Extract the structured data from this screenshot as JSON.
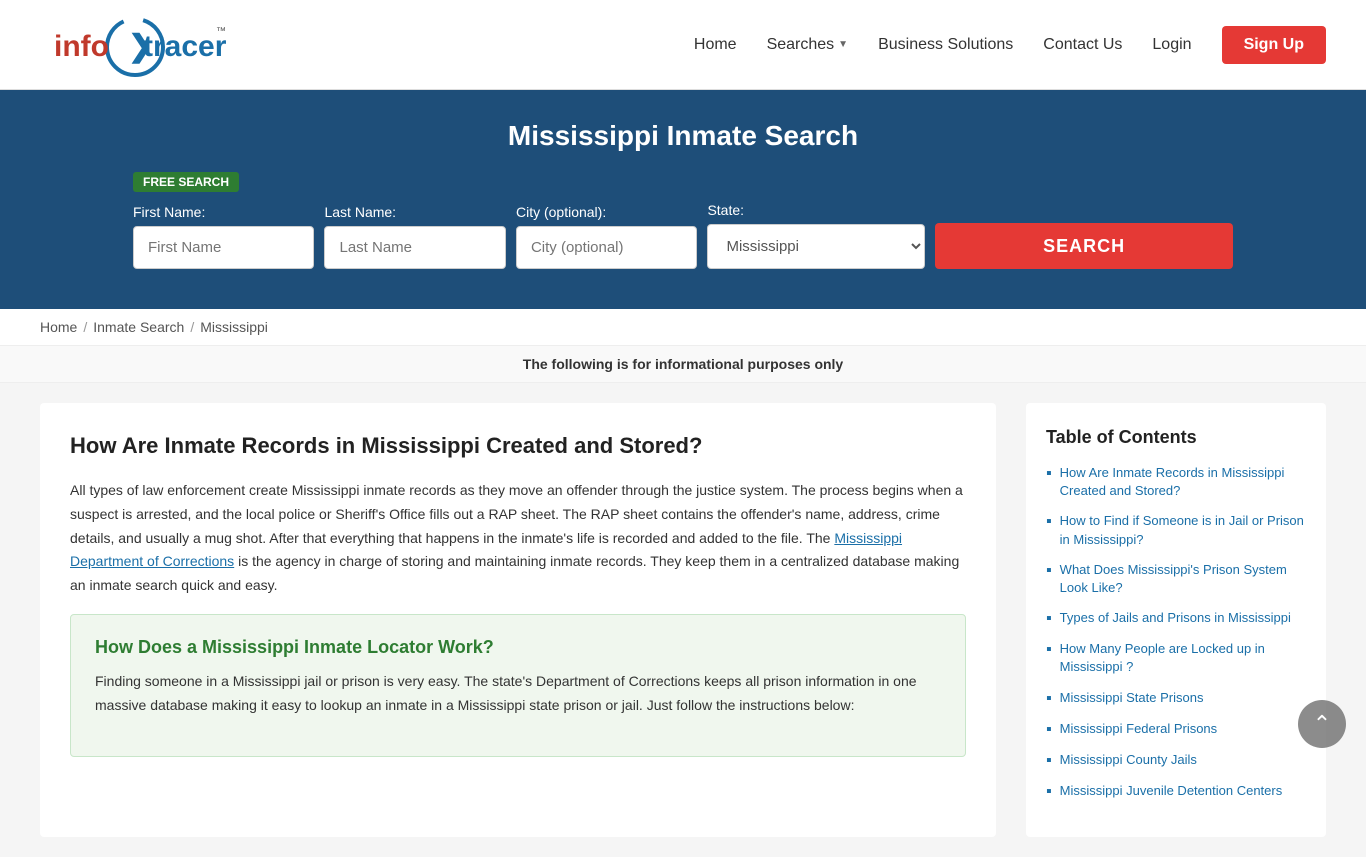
{
  "header": {
    "logo_alt": "InfoTracer",
    "nav": [
      {
        "label": "Home",
        "has_dropdown": false
      },
      {
        "label": "Searches",
        "has_dropdown": true
      },
      {
        "label": "Business Solutions",
        "has_dropdown": false
      },
      {
        "label": "Contact Us",
        "has_dropdown": false
      }
    ],
    "login_label": "Login",
    "signup_label": "Sign Up"
  },
  "hero": {
    "title": "Mississippi Inmate Search",
    "free_badge": "FREE SEARCH",
    "form": {
      "first_name_label": "First Name:",
      "first_name_placeholder": "First Name",
      "last_name_label": "Last Name:",
      "last_name_placeholder": "Last Name",
      "city_label": "City (optional):",
      "city_placeholder": "City (optional)",
      "state_label": "State:",
      "state_value": "Mississippi",
      "search_label": "SEARCH"
    }
  },
  "breadcrumb": {
    "home": "Home",
    "inmate_search": "Inmate Search",
    "state": "Mississippi"
  },
  "info_bar": "The following is for informational purposes only",
  "article": {
    "heading": "How Are Inmate Records in Mississippi Created and Stored?",
    "paragraph1": "All types of law enforcement create Mississippi inmate records as they move an offender through the justice system. The process begins when a suspect is arrested, and the local police or Sheriff's Office fills out a RAP sheet. The RAP sheet contains the offender's name, address, crime details, and usually a mug shot. After that everything that happens in the inmate's life is recorded and added to the file. The",
    "link_text": "Mississippi Department of Corrections",
    "paragraph1_end": "is the agency in charge of storing and maintaining inmate records. They keep them in a centralized database making an inmate search quick and easy.",
    "green_box": {
      "heading": "How Does a Mississippi Inmate Locator Work?",
      "paragraph": "Finding someone in a Mississippi jail or prison is very easy. The state's Department of Corrections keeps all prison information in one massive database making it easy to lookup an inmate in a Mississippi state prison or jail. Just follow the instructions below:"
    }
  },
  "toc": {
    "heading": "Table of Contents",
    "items": [
      {
        "label": "How Are Inmate Records in Mississippi Created and Stored?"
      },
      {
        "label": "How to Find if Someone is in Jail or Prison in Mississippi?"
      },
      {
        "label": "What Does Mississippi's Prison System Look Like?"
      },
      {
        "label": "Types of Jails and Prisons in Mississippi"
      },
      {
        "label": "How Many People are Locked up in Mississippi ?"
      },
      {
        "label": "Mississippi State Prisons"
      },
      {
        "label": "Mississippi Federal Prisons"
      },
      {
        "label": "Mississippi County Jails"
      },
      {
        "label": "Mississippi Juvenile Detention Centers"
      }
    ]
  }
}
